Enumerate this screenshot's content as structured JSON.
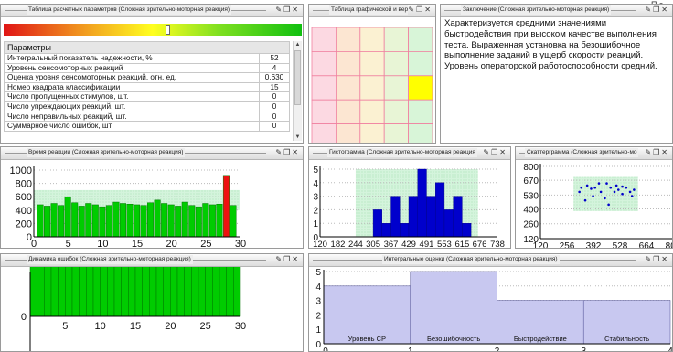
{
  "top_right_fragment": "П з",
  "windows": {
    "params": {
      "title": "Таблица расчетных параметров (Сложная зрительно-моторная реакция)",
      "header": "Параметры",
      "rows": [
        {
          "label": "Интегральный показатель надежности, %",
          "value": "52"
        },
        {
          "label": "Уровень сенсомоторных реакций",
          "value": "4"
        },
        {
          "label": "Оценка уровня сенсомоторных реакций, отн. ед.",
          "value": "0.630"
        },
        {
          "label": "Номер квадрата классификации",
          "value": "15"
        },
        {
          "label": "Число пропущенных стимулов, шт.",
          "value": "0"
        },
        {
          "label": "Число упреждающих реакций, шт.",
          "value": "0"
        },
        {
          "label": "Число неправильных реакций, шт.",
          "value": "0"
        },
        {
          "label": "Суммарное число ошибок, шт.",
          "value": "0"
        }
      ],
      "indicator_level": 0.55
    },
    "grid": {
      "title": "Таблица графической и вер",
      "columns": 5,
      "rows": 5,
      "highlight": {
        "row": 2,
        "col": 4,
        "color": "#ffff00"
      },
      "column_colors": [
        "#fcd9e2",
        "#fce6d2",
        "#fbf1d2",
        "#e8f5d6",
        "#d8f5d8"
      ]
    },
    "conclusion": {
      "title": "Заключение (Сложная зрительно-моторная реакция)",
      "text": "Характеризуется средними значениями быстродействия при высоком качестве выполнения теста. Выраженная установка на безошибочное выполнение заданий в ущерб скорости реакций. Уровень операторской работоспособности средний."
    },
    "reaction_time": {
      "title": "Время реакции (Сложная зрительно-моторная реакция)"
    },
    "histogram": {
      "title": "Гистограмма (Сложная зрительно-моторная реакция"
    },
    "scatter": {
      "title": "Скаттерграмма (Сложная зрительно-мо"
    },
    "errors": {
      "title": "Динамика ошибок (Сложная зрительно-моторная реакция)"
    },
    "integral": {
      "title": "Интегральные оценки (Сложная зрительно-моторная реакция)"
    }
  },
  "window_buttons": {
    "pin": "✎",
    "restore": "❐",
    "close": "✕"
  },
  "colors": {
    "green_bar": "#00cc00",
    "red_bar": "#ee1111",
    "blue_bar": "#0000cc",
    "purple_bar": "#c8c8f0",
    "band": "#d4f4dc"
  },
  "chart_data": [
    {
      "name": "reaction_time",
      "type": "bar",
      "x": [
        1,
        2,
        3,
        4,
        5,
        6,
        7,
        8,
        9,
        10,
        11,
        12,
        13,
        14,
        15,
        16,
        17,
        18,
        19,
        20,
        21,
        22,
        23,
        24,
        25,
        26,
        27,
        28,
        29
      ],
      "values": [
        480,
        460,
        500,
        470,
        600,
        510,
        460,
        500,
        480,
        450,
        470,
        520,
        500,
        490,
        480,
        470,
        510,
        550,
        500,
        480,
        460,
        520,
        470,
        450,
        500,
        480,
        490,
        920,
        470
      ],
      "highlight_index": 27,
      "band": [
        400,
        700
      ],
      "xlim": [
        0,
        30
      ],
      "ylim": [
        0,
        1000
      ],
      "xticks": [
        0,
        5,
        10,
        15,
        20,
        25,
        30
      ],
      "yticks": [
        0,
        200,
        400,
        600,
        800,
        1000
      ],
      "ytick_labels": [
        "0",
        "200",
        "400",
        "600",
        "800",
        "1000"
      ]
    },
    {
      "name": "histogram",
      "type": "bar",
      "x": [
        120,
        182,
        244,
        305,
        367,
        429,
        491,
        553,
        615,
        676,
        738
      ],
      "xtick_labels": [
        "120",
        "182",
        "244",
        "305",
        "367",
        "429",
        "491",
        "553",
        "615",
        "676",
        "738"
      ],
      "bins": [
        {
          "from": 305,
          "to": 336,
          "value": 2
        },
        {
          "from": 336,
          "to": 367,
          "value": 1
        },
        {
          "from": 367,
          "to": 398,
          "value": 3
        },
        {
          "from": 398,
          "to": 429,
          "value": 1
        },
        {
          "from": 429,
          "to": 460,
          "value": 3
        },
        {
          "from": 460,
          "to": 491,
          "value": 5
        },
        {
          "from": 491,
          "to": 522,
          "value": 3
        },
        {
          "from": 522,
          "to": 553,
          "value": 4
        },
        {
          "from": 553,
          "to": 584,
          "value": 2
        },
        {
          "from": 584,
          "to": 615,
          "value": 3
        },
        {
          "from": 615,
          "to": 646,
          "value": 1
        }
      ],
      "band": [
        244,
        670
      ],
      "ylim": [
        0,
        5
      ],
      "yticks": [
        0,
        1,
        2,
        3,
        4,
        5
      ]
    },
    {
      "name": "scatter",
      "type": "scatter",
      "points": [
        [
          320,
          560
        ],
        [
          330,
          600
        ],
        [
          360,
          620
        ],
        [
          390,
          520
        ],
        [
          400,
          600
        ],
        [
          430,
          560
        ],
        [
          460,
          640
        ],
        [
          480,
          600
        ],
        [
          500,
          560
        ],
        [
          510,
          620
        ],
        [
          520,
          580
        ],
        [
          540,
          540
        ],
        [
          560,
          600
        ],
        [
          580,
          560
        ],
        [
          600,
          580
        ],
        [
          450,
          500
        ],
        [
          350,
          480
        ],
        [
          470,
          440
        ],
        [
          590,
          520
        ],
        [
          420,
          640
        ],
        [
          380,
          590
        ],
        [
          540,
          610
        ]
      ],
      "band_x": [
        290,
        620
      ],
      "band_y": [
        380,
        700
      ],
      "xlim": [
        120,
        800
      ],
      "ylim": [
        120,
        800
      ],
      "xticks": [
        120,
        256,
        392,
        528,
        664,
        800
      ],
      "yticks": [
        120,
        260,
        400,
        530,
        670,
        800
      ],
      "ytick_labels": [
        "120",
        "260",
        "400",
        "530",
        "670",
        "800"
      ]
    },
    {
      "name": "errors",
      "type": "bar",
      "x": [
        1,
        2,
        3,
        4,
        5,
        6,
        7,
        8,
        9,
        10,
        11,
        12,
        13,
        14,
        15,
        16,
        17,
        18,
        19,
        20,
        21,
        22,
        23,
        24,
        25,
        26,
        27,
        28,
        29,
        30
      ],
      "values": [
        1,
        1,
        1,
        1,
        1,
        1,
        1,
        1,
        1,
        1,
        1,
        1,
        1,
        1,
        1,
        1,
        1,
        1,
        1,
        1,
        1,
        1,
        1,
        1,
        1,
        1,
        1,
        1,
        1,
        1
      ],
      "xlim": [
        0,
        30
      ],
      "ylim": [
        0,
        1.2
      ],
      "xticks": [
        5,
        10,
        15,
        20,
        25,
        30
      ],
      "yticks": [
        0,
        1
      ]
    },
    {
      "name": "integral",
      "type": "bar",
      "categories": [
        "Уровень СР",
        "Безошибочность",
        "Быстродействие",
        "Стабильность"
      ],
      "values": [
        4,
        5,
        3,
        3
      ],
      "xlim": [
        0,
        4
      ],
      "ylim": [
        0,
        5
      ],
      "xticks": [
        0,
        1,
        2,
        3,
        4
      ],
      "yticks": [
        0,
        1,
        2,
        3,
        4,
        5
      ]
    }
  ]
}
